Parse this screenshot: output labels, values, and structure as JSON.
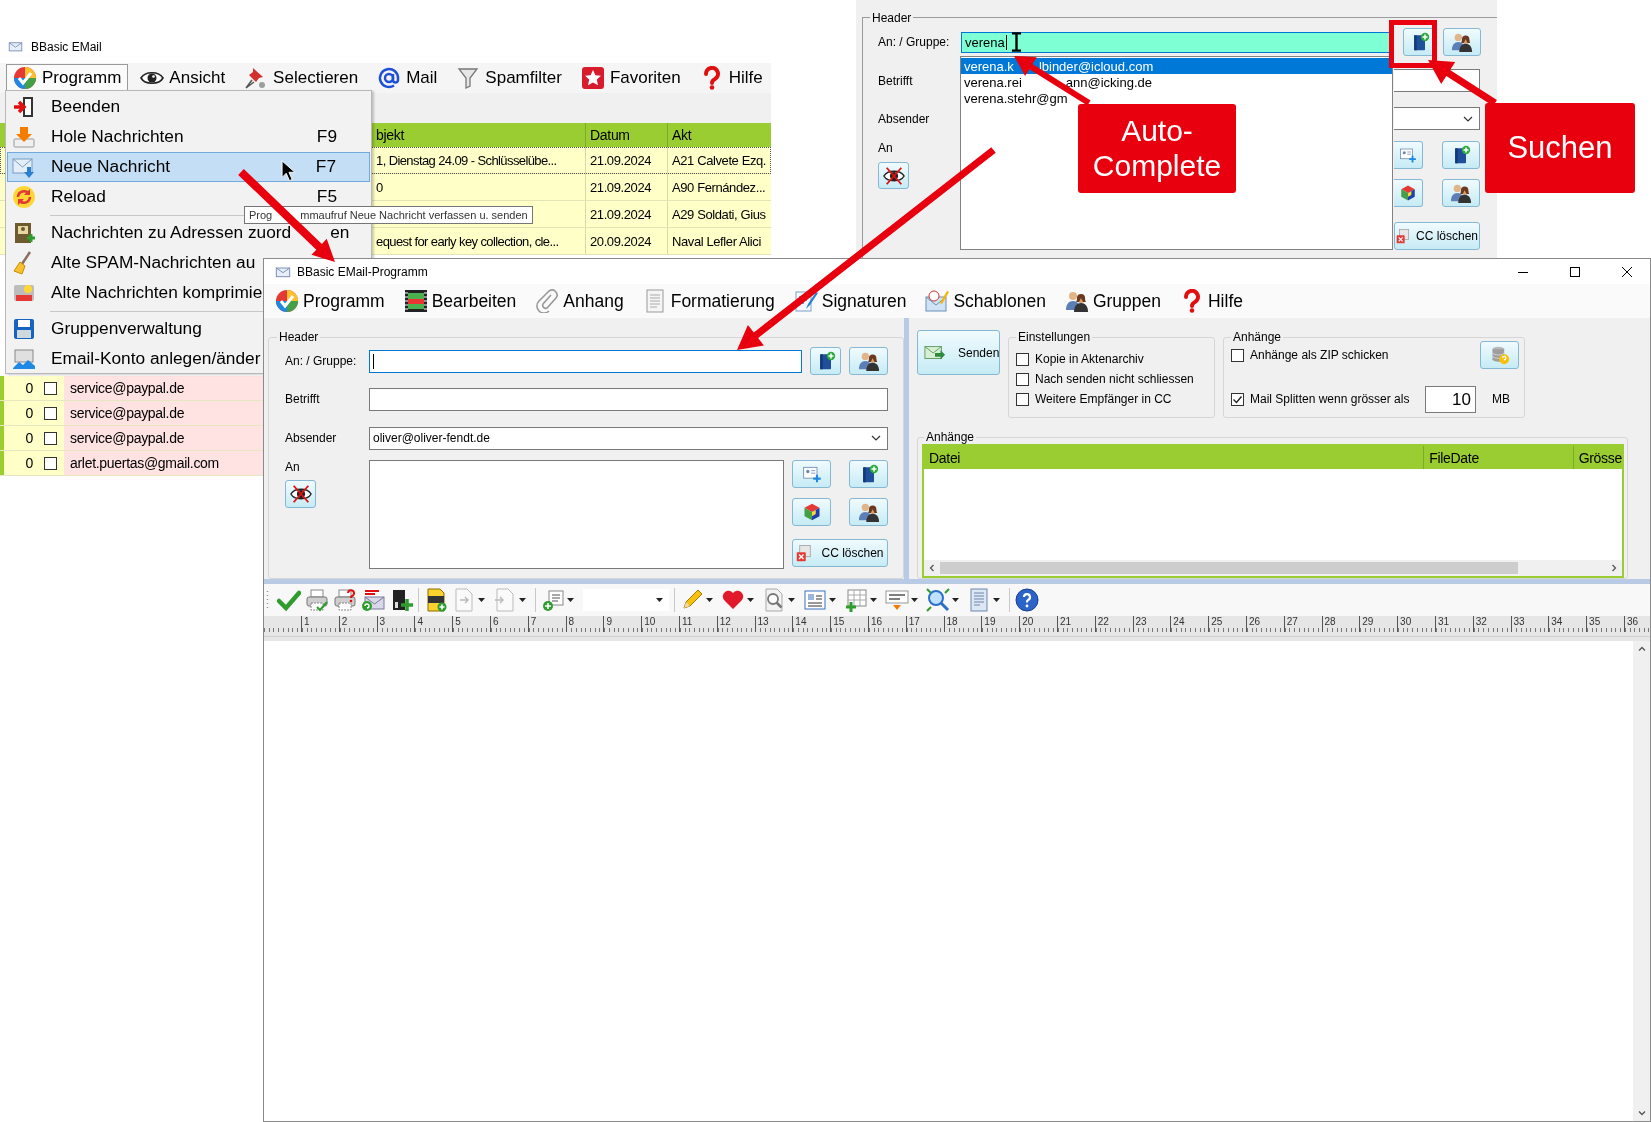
{
  "main_window": {
    "title": "BBasic EMail",
    "menu": [
      {
        "label": "Programm",
        "selected": true
      },
      {
        "label": "Ansicht",
        "selected": false
      },
      {
        "label": "Selectieren",
        "selected": false
      },
      {
        "label": "Mail",
        "selected": false
      },
      {
        "label": "Spamfilter",
        "selected": false
      },
      {
        "label": "Favoriten",
        "selected": false
      },
      {
        "label": "Hilfe",
        "selected": false
      }
    ],
    "message_table": {
      "columns": [
        "bjekt",
        "Datum",
        "Akt"
      ],
      "rows": [
        {
          "subject": "1, Dienstag 24.09 - Schlüsselübe...",
          "date": "21.09.2024",
          "akt": "A21 Calvete Ezq."
        },
        {
          "subject": "0",
          "date": "21.09.2024",
          "akt": "A90 Fernández..."
        },
        {
          "date": "21.09.2024",
          "akt": "A29 Soldati, Gius"
        },
        {
          "subject": "equest for early key collection, cle...",
          "date": "20.09.2024",
          "akt": "Naval Lefler Alici"
        }
      ]
    },
    "address_rows": [
      {
        "count": "0",
        "checked": false,
        "email": "service@paypal.de"
      },
      {
        "count": "0",
        "checked": false,
        "email": "service@paypal.de"
      },
      {
        "count": "0",
        "checked": false,
        "email": "service@paypal.de"
      },
      {
        "count": "0",
        "checked": false,
        "email": "arlet.puertas@gmail.com"
      }
    ]
  },
  "program_menu": [
    {
      "kind": "item",
      "label": "Beenden",
      "selected": false
    },
    {
      "kind": "item",
      "label": "Hole Nachrichten",
      "shortcut": "F9",
      "selected": false
    },
    {
      "kind": "item",
      "label": "Neue Nachricht",
      "shortcut": "F7",
      "selected": true
    },
    {
      "kind": "item",
      "label": "Reload",
      "shortcut": "F5",
      "selected": false
    },
    {
      "kind": "separator"
    },
    {
      "kind": "item",
      "label": "Nachrichten zu Adressen zuord",
      "label_tail": "en",
      "selected": false
    },
    {
      "kind": "item",
      "label": "Alte SPAM-Nachrichten au",
      "selected": false
    },
    {
      "kind": "item",
      "label": "Alte Nachrichten komprimie",
      "selected": false
    },
    {
      "kind": "separator"
    },
    {
      "kind": "item",
      "label": "Gruppenverwaltung",
      "selected": false
    },
    {
      "kind": "item",
      "label": "Email-Konto anlegen/änder",
      "selected": false
    }
  ],
  "tooltip": {
    "text": "Prog",
    "text_tail": "mmaufruf Neue Nachricht verfassen u. senden"
  },
  "autocomplete_inset": {
    "group_title": "Header",
    "to_label": "An: / Gruppe:",
    "to_value": "verena",
    "suggestions": [
      {
        "parts": [
          "verena.k",
          "lbinder@icloud.com"
        ],
        "selected": true
      },
      {
        "parts": [
          "verena.rei",
          "ann@icking.de"
        ],
        "selected": false
      },
      {
        "parts": [
          "verena.stehr@gm"
        ],
        "selected": false
      }
    ],
    "subject_label": "Betrifft",
    "sender_label": "Absender",
    "recipients_label": "An",
    "cc_clear_button": "CC löschen"
  },
  "compose_window": {
    "title": "BBasic EMail-Programm",
    "menu": [
      "Programm",
      "Bearbeiten",
      "Anhang",
      "Formatierung",
      "Signaturen",
      "Schablonen",
      "Gruppen",
      "Hilfe"
    ],
    "header": {
      "group_title": "Header",
      "to_label": "An: / Gruppe:",
      "subject_label": "Betrifft",
      "sender_label": "Absender",
      "sender_value": "oliver@oliver-fendt.de",
      "recipients_label": "An",
      "cc_clear_button": "CC löschen"
    },
    "send_button": "Senden",
    "settings": {
      "title": "Einstellungen",
      "options": [
        {
          "label": "Kopie in Aktenarchiv",
          "checked": false
        },
        {
          "label": "Nach senden nicht schliessen",
          "checked": false
        },
        {
          "label": "Weitere Empfänger in CC",
          "checked": false
        }
      ]
    },
    "attachment_options": {
      "title": "Anhänge",
      "zip": {
        "label": "Anhänge als ZIP schicken",
        "checked": false
      },
      "split": {
        "label": "Mail Splitten wenn grösser als",
        "checked": true,
        "size": "10",
        "unit": "MB"
      }
    },
    "attachments": {
      "title": "Anhänge",
      "columns": [
        "Datei",
        "FileDate",
        "Grösse"
      ]
    },
    "ruler": [
      "1",
      "2",
      "3",
      "4",
      "5",
      "6",
      "7",
      "8",
      "9",
      "10",
      "11",
      "12",
      "13",
      "14",
      "15",
      "16",
      "17",
      "18",
      "19",
      "20",
      "21",
      "22",
      "23",
      "24",
      "25",
      "26",
      "27",
      "28",
      "29",
      "30",
      "31",
      "32",
      "33",
      "34",
      "35",
      "36"
    ]
  },
  "annotations": [
    {
      "text": "Auto-Complete"
    },
    {
      "text": "Suchen"
    }
  ]
}
